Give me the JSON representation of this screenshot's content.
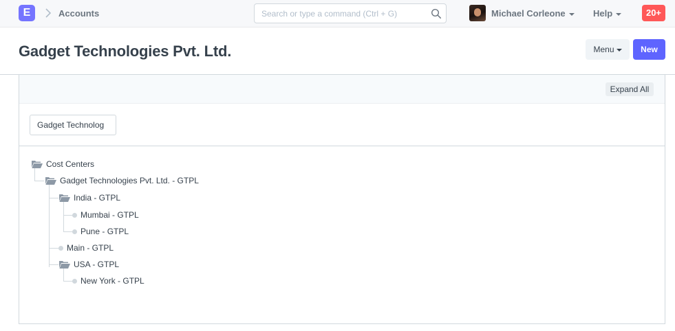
{
  "navbar": {
    "logo_letter": "E",
    "breadcrumb": "Accounts",
    "search_placeholder": "Search or type a command (Ctrl + G)",
    "user_name": "Michael Corleone",
    "help_label": "Help",
    "notification_count": "20+"
  },
  "page": {
    "title": "Gadget Technologies Pvt. Ltd.",
    "menu_label": "Menu",
    "new_label": "New"
  },
  "toolbar": {
    "expand_all_label": "Expand All"
  },
  "filter": {
    "company_value": "Gadget Technolog"
  },
  "tree": {
    "root": "Cost Centers",
    "company": "Gadget Technologies Pvt. Ltd. - GTPL",
    "india": "India - GTPL",
    "mumbai": "Mumbai - GTPL",
    "pune": "Pune - GTPL",
    "main": "Main - GTPL",
    "usa": "USA - GTPL",
    "new_york": "New York - GTPL"
  },
  "colors": {
    "primary": "#5e64ff",
    "logo": "#7574ff",
    "notification": "#ff5858",
    "text": "#36414c",
    "muted": "#6c7680"
  }
}
